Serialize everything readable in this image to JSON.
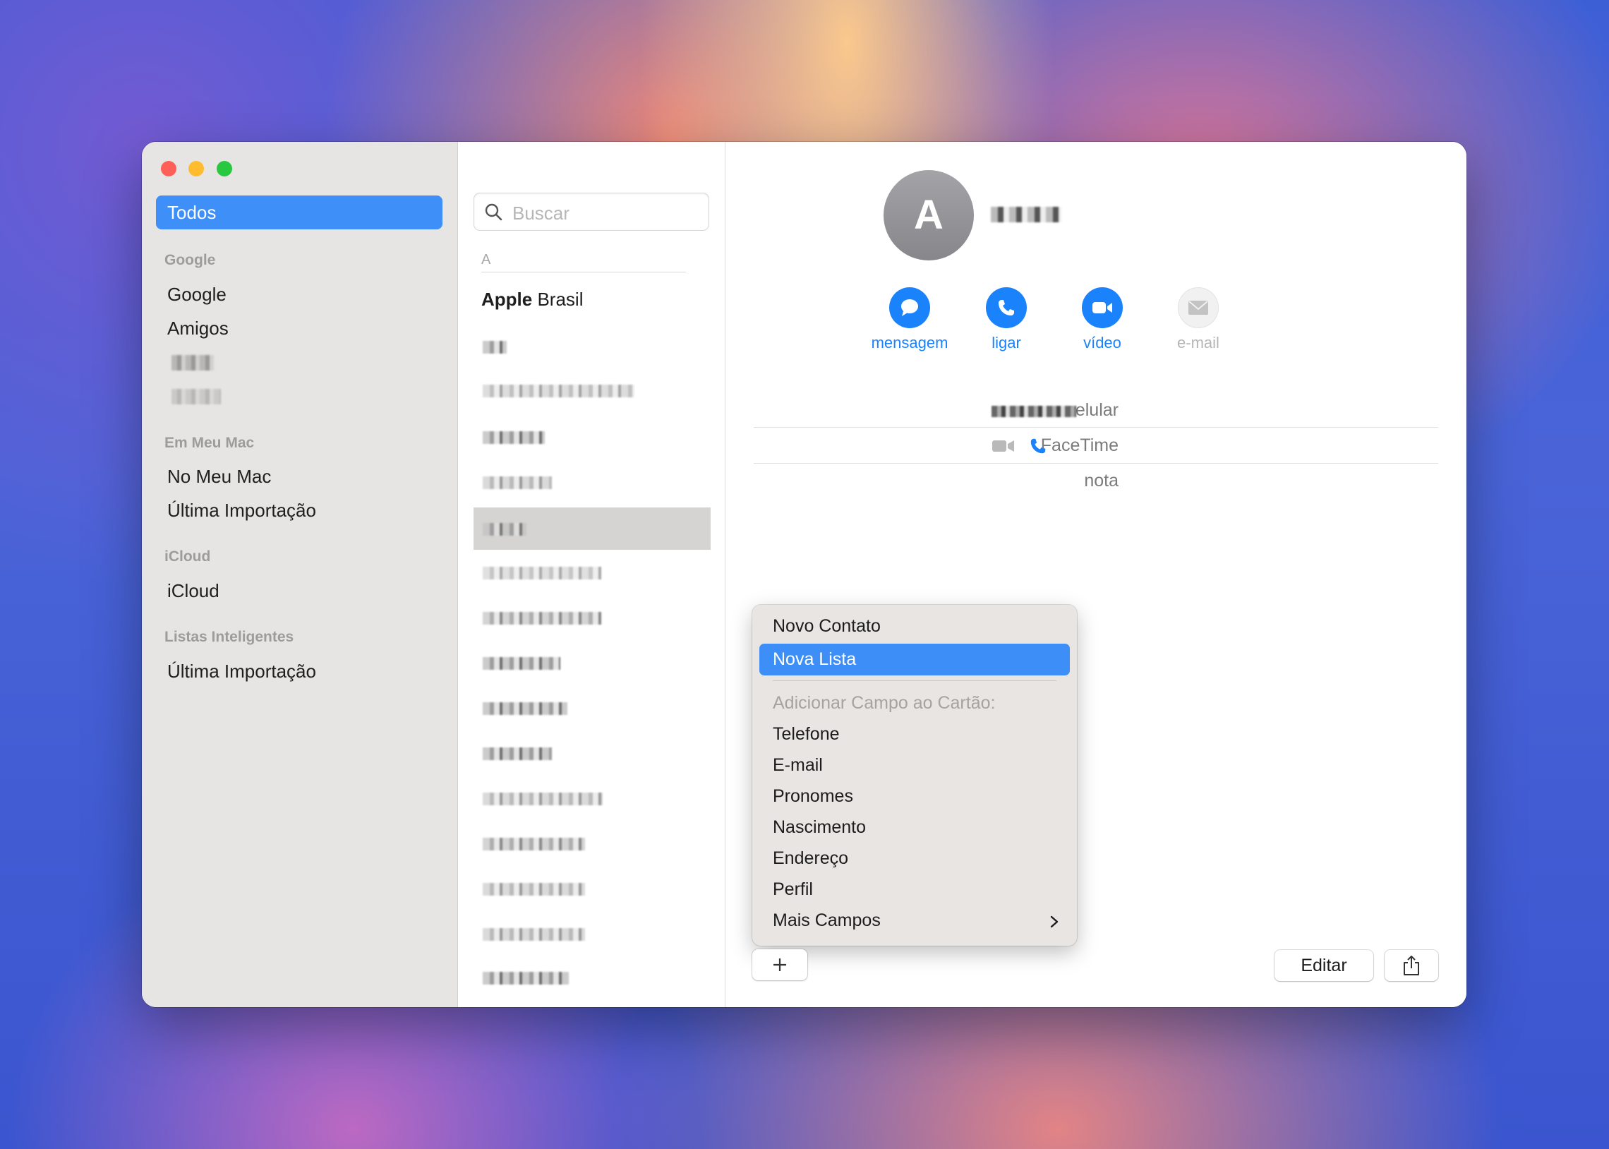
{
  "sidebar": {
    "selected": "Todos",
    "groups": [
      {
        "heading": "Google",
        "items": [
          "Google",
          "Amigos"
        ]
      },
      {
        "heading": "Em Meu Mac",
        "items": [
          "No Meu Mac",
          "Última Importação"
        ]
      },
      {
        "heading": "iCloud",
        "items": [
          "iCloud"
        ]
      },
      {
        "heading": "Listas Inteligentes",
        "items": [
          "Última Importação"
        ]
      }
    ]
  },
  "list": {
    "search_placeholder": "Buscar",
    "section_letter": "A",
    "first_contact_bold": "Apple",
    "first_contact_rest": " Brasil"
  },
  "detail": {
    "avatar_initial": "A",
    "actions": {
      "message": "mensagem",
      "call": "ligar",
      "video": "vídeo",
      "email": "e-mail"
    },
    "fields": {
      "mobile": "celular",
      "facetime": "FaceTime",
      "note": "nota"
    }
  },
  "menu": {
    "new_contact": "Novo Contato",
    "new_list": "Nova Lista",
    "add_field_header": "Adicionar Campo ao Cartão:",
    "phone": "Telefone",
    "email": "E-mail",
    "pronouns": "Pronomes",
    "birthday": "Nascimento",
    "address": "Endereço",
    "profile": "Perfil",
    "more_fields": "Mais Campos"
  },
  "buttons": {
    "edit": "Editar"
  },
  "colors": {
    "accent": "#3e8ff7",
    "action_blue": "#1a82fb",
    "close": "#fe5f57",
    "minimize": "#febc2e",
    "zoom": "#28c840"
  }
}
